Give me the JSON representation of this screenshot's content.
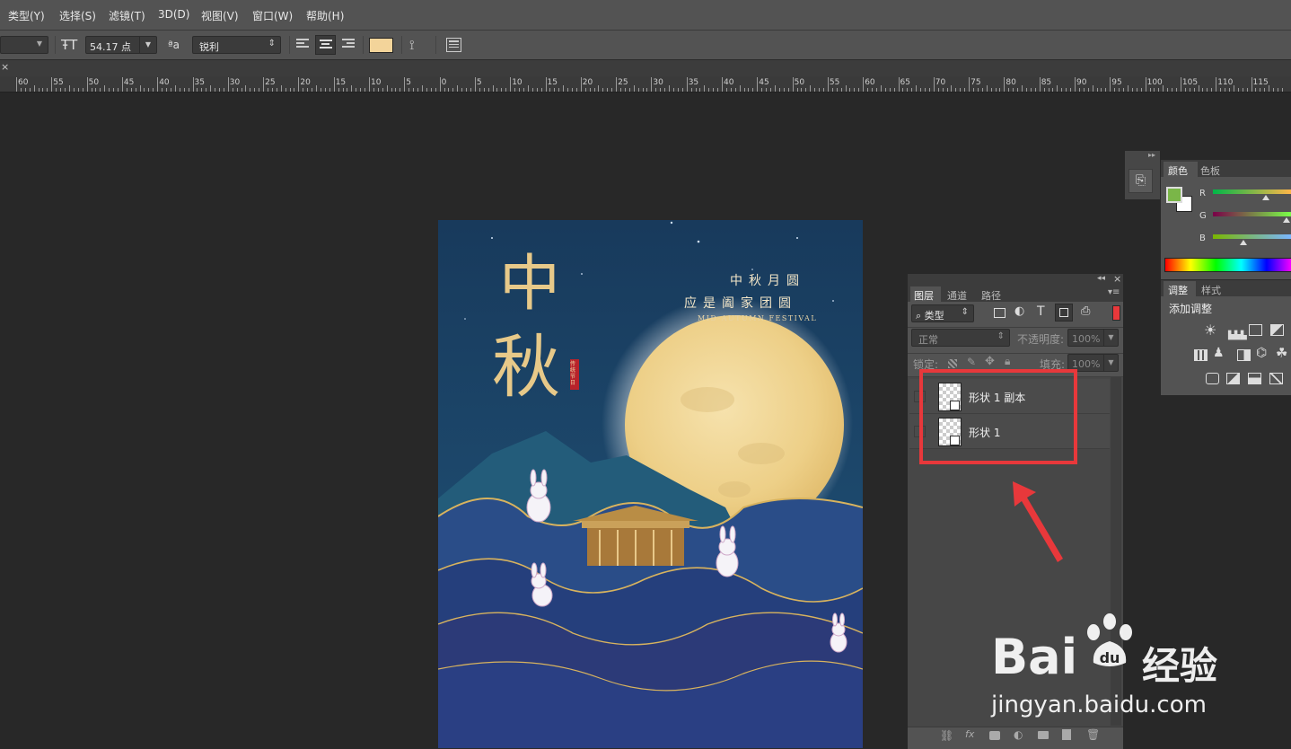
{
  "menu": [
    "类型(Y)",
    "选择(S)",
    "滤镜(T)",
    "3D(D)",
    "视图(V)",
    "窗口(W)",
    "帮助(H)"
  ],
  "options": {
    "font_size": "54.17 点",
    "aa_label": "ªa",
    "antialias": "锐利",
    "text_color": "#f3d49a"
  },
  "ruler_labels": [
    "60",
    "55",
    "50",
    "45",
    "40",
    "35",
    "30",
    "25",
    "20",
    "15",
    "10",
    "5",
    "0",
    "5",
    "10",
    "15",
    "20",
    "25",
    "30",
    "35",
    "40",
    "45",
    "50",
    "55",
    "60",
    "65",
    "70",
    "75",
    "80",
    "85",
    "90",
    "95",
    "100",
    "105",
    "110",
    "115"
  ],
  "poster": {
    "title_char_1": "中",
    "title_char_2": "秋",
    "line1": "中秋月圆",
    "line2": "应是阖家团圆",
    "english": "MID-AUTUMN FESTIVAL",
    "seal": "传统节日"
  },
  "color_panel": {
    "tabs": [
      "颜色",
      "色板"
    ],
    "channels": [
      "R",
      "G",
      "B"
    ],
    "foreground": "#7ab648"
  },
  "adjust_panel": {
    "tabs": [
      "调整",
      "样式"
    ],
    "title": "添加调整"
  },
  "layers_panel": {
    "tabs": [
      "图层",
      "通道",
      "路径"
    ],
    "filter_type": "类型",
    "blend_mode": "正常",
    "opacity_label": "不透明度:",
    "opacity_value": "100%",
    "lock_label": "锁定:",
    "fill_label": "填充:",
    "fill_value": "100%",
    "layers": [
      {
        "name": "形状 1 副本"
      },
      {
        "name": "形状 1"
      }
    ]
  },
  "watermark": {
    "brand": "Bai",
    "brand2": "经验",
    "url": "jingyan.baidu.com"
  },
  "colors": {
    "highlight": "#e8383b"
  }
}
